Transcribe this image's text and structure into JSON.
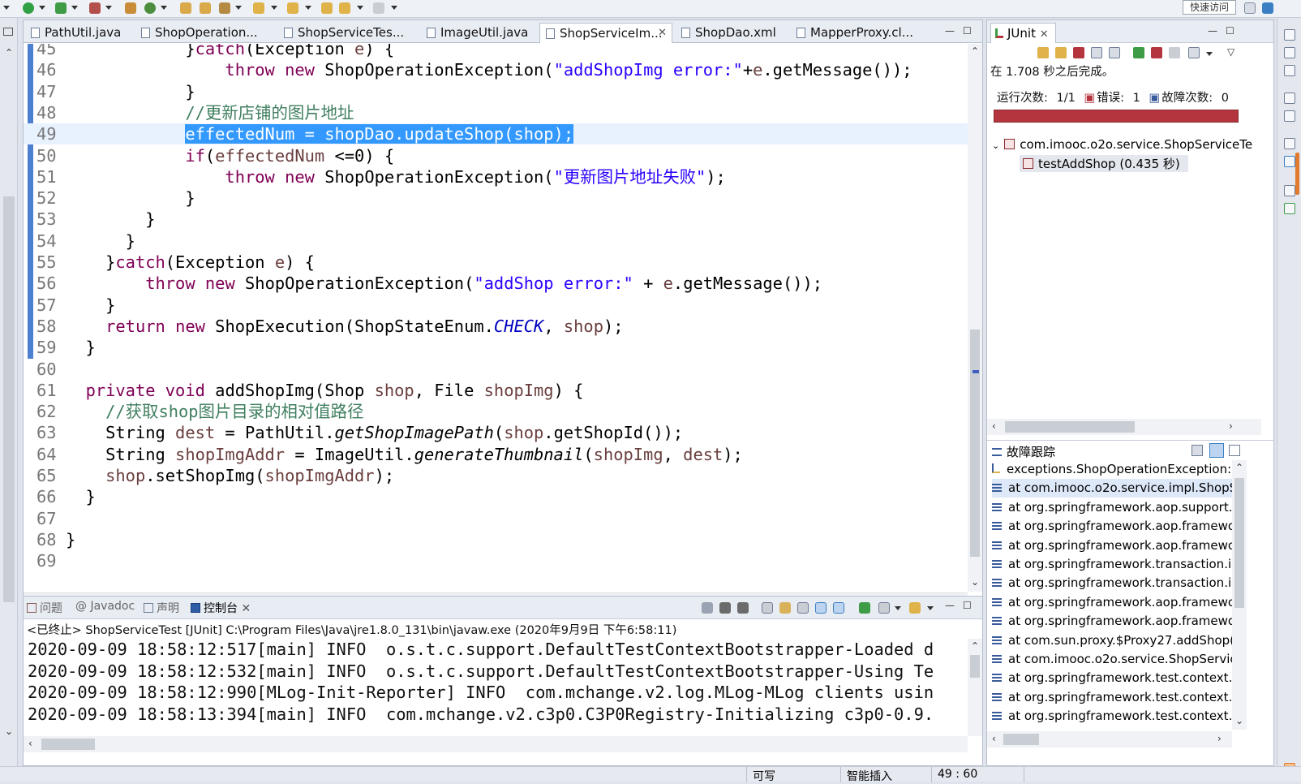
{
  "toolbar": {
    "quick_access": "快速访问"
  },
  "editor_tabs": [
    {
      "label": "PathUtil.java"
    },
    {
      "label": "ShopOperation..."
    },
    {
      "label": "ShopServiceTes..."
    },
    {
      "label": "ImageUtil.java"
    },
    {
      "label": "ShopServiceIm...",
      "active": true,
      "close": "✕"
    },
    {
      "label": "ShopDao.xml"
    },
    {
      "label": "MapperProxy.cl..."
    }
  ],
  "code_lines": [
    {
      "num": "45",
      "html": "            }<span class='kw'>catch</span>(Exception <span class='var'>e</span>) {"
    },
    {
      "num": "46",
      "html": "                <span class='kw'>throw</span> <span class='kw'>new</span> ShopOperationException(<span class='str'>\"addShopImg error:\"</span>+<span class='var'>e</span>.getMessage());"
    },
    {
      "num": "47",
      "html": "            }"
    },
    {
      "num": "48",
      "html": "            <span class='cmt'>//更新店铺的图片地址</span>"
    },
    {
      "num": "49",
      "html": "            <span class='sel'>effectedNum = shopDao.updateShop(shop);</span>",
      "highlight": true
    },
    {
      "num": "50",
      "html": "            <span class='kw'>if</span>(<span class='var'>effectedNum</span> &lt;=0) {"
    },
    {
      "num": "51",
      "html": "                <span class='kw'>throw</span> <span class='kw'>new</span> ShopOperationException(<span class='str'>\"更新图片地址失败\"</span>);"
    },
    {
      "num": "52",
      "html": "            }"
    },
    {
      "num": "53",
      "html": "        }"
    },
    {
      "num": "54",
      "html": "      }"
    },
    {
      "num": "55",
      "html": "    }<span class='kw'>catch</span>(Exception <span class='var'>e</span>) {"
    },
    {
      "num": "56",
      "html": "        <span class='kw'>throw</span> <span class='kw'>new</span> ShopOperationException(<span class='str'>\"addShop error:\"</span> + <span class='var'>e</span>.getMessage());"
    },
    {
      "num": "57",
      "html": "    }"
    },
    {
      "num": "58",
      "html": "    <span class='kw'>return</span> <span class='kw'>new</span> ShopExecution(ShopStateEnum.<span class='fld'>CHECK</span>, <span class='var'>shop</span>);"
    },
    {
      "num": "59",
      "html": "  }"
    },
    {
      "num": "60",
      "html": ""
    },
    {
      "num": "61",
      "html": "  <span class='kw'>private</span> <span class='kw'>void</span> addShopImg(Shop <span class='var'>shop</span>, File <span class='var'>shopImg</span>) {"
    },
    {
      "num": "62",
      "html": "    <span class='cmt'>//获取shop图片目录的相对值路径</span>"
    },
    {
      "num": "63",
      "html": "    String <span class='var'>dest</span> = PathUtil.<span class='it'>getShopImagePath</span>(<span class='var'>shop</span>.getShopId());"
    },
    {
      "num": "64",
      "html": "    String <span class='var'>shopImgAddr</span> = ImageUtil.<span class='it'>generateThumbnail</span>(<span class='var'>shopImg</span>, <span class='var'>dest</span>);"
    },
    {
      "num": "65",
      "html": "    <span class='var'>shop</span>.setShopImg(<span class='var'>shopImgAddr</span>);"
    },
    {
      "num": "66",
      "html": "  }"
    },
    {
      "num": "67",
      "html": ""
    },
    {
      "num": "68",
      "html": "}"
    },
    {
      "num": "69",
      "html": ""
    }
  ],
  "console": {
    "tabs": [
      "问题",
      "@ Javadoc",
      "声明",
      "控制台"
    ],
    "status": "<已终止> ShopServiceTest [JUnit] C:\\Program Files\\Java\\jre1.8.0_131\\bin\\javaw.exe  (2020年9月9日 下午6:58:11)",
    "lines": [
      "2020-09-09 18:58:12:517[main] INFO  o.s.t.c.support.DefaultTestContextBootstrapper-Loaded d",
      "2020-09-09 18:58:12:532[main] INFO  o.s.t.c.support.DefaultTestContextBootstrapper-Using Te",
      "2020-09-09 18:58:12:990[MLog-Init-Reporter] INFO  com.mchange.v2.log.MLog-MLog clients usin",
      "2020-09-09 18:58:13:394[main] INFO  com.mchange.v2.c3p0.C3P0Registry-Initializing c3p0-0.9."
    ]
  },
  "junit": {
    "tab": "JUnit",
    "finished": "在 1.708 秒之后完成。",
    "runs_label": "运行次数:",
    "runs": "1/1",
    "errors_label": "错误:",
    "errors": "1",
    "failures_label": "故障次数:",
    "failures": "0",
    "progress": 1.0,
    "tree_root": "com.imooc.o2o.service.ShopServiceTe",
    "tree_child": "testAddShop  (0.435 秒)",
    "trace_title": "故障跟踪",
    "trace": [
      "exceptions.ShopOperationException:",
      "at com.imooc.o2o.service.impl.ShopS",
      "at org.springframework.aop.support.",
      "at org.springframework.aop.framewo",
      "at org.springframework.aop.framewo",
      "at org.springframework.transaction.in",
      "at org.springframework.transaction.in",
      "at org.springframework.aop.framewo",
      "at org.springframework.aop.framewo",
      "at com.sun.proxy.$Proxy27.addShop(",
      "at com.imooc.o2o.service.ShopServic",
      "at org.springframework.test.context.j",
      "at org.springframework.test.context.j",
      "at org.springframework.test.context.j"
    ]
  },
  "statusbar": {
    "writable": "可写",
    "insert": "智能插入",
    "position": "49 : 60"
  }
}
